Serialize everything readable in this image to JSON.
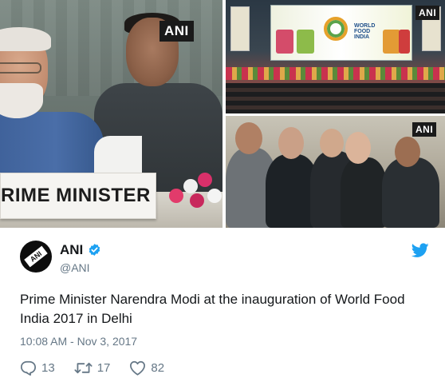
{
  "media": {
    "main_photo": {
      "watermark": "ANI",
      "nameplate_text": "RIME MINISTER"
    },
    "hall_photo": {
      "watermark": "ANI",
      "screen_text_line1": "WORLD",
      "screen_text_line2": "FOOD",
      "screen_text_line3": "INDIA"
    },
    "audience_photo": {
      "watermark": "ANI"
    }
  },
  "tweet": {
    "author_name": "ANI",
    "author_handle": "@ANI",
    "avatar_label": "ANI",
    "verified_icon": "verified-badge-icon",
    "brand_icon": "twitter-bird-icon",
    "text": "Prime Minister Narendra Modi at the inauguration of World Food India 2017 in Delhi",
    "timestamp": "10:08 AM - Nov 3, 2017",
    "actions": {
      "reply_count": "13",
      "retweet_count": "17",
      "like_count": "82"
    },
    "colors": {
      "accent": "#1da1f2",
      "secondary_text": "#657786",
      "primary_text": "#14171a"
    }
  }
}
